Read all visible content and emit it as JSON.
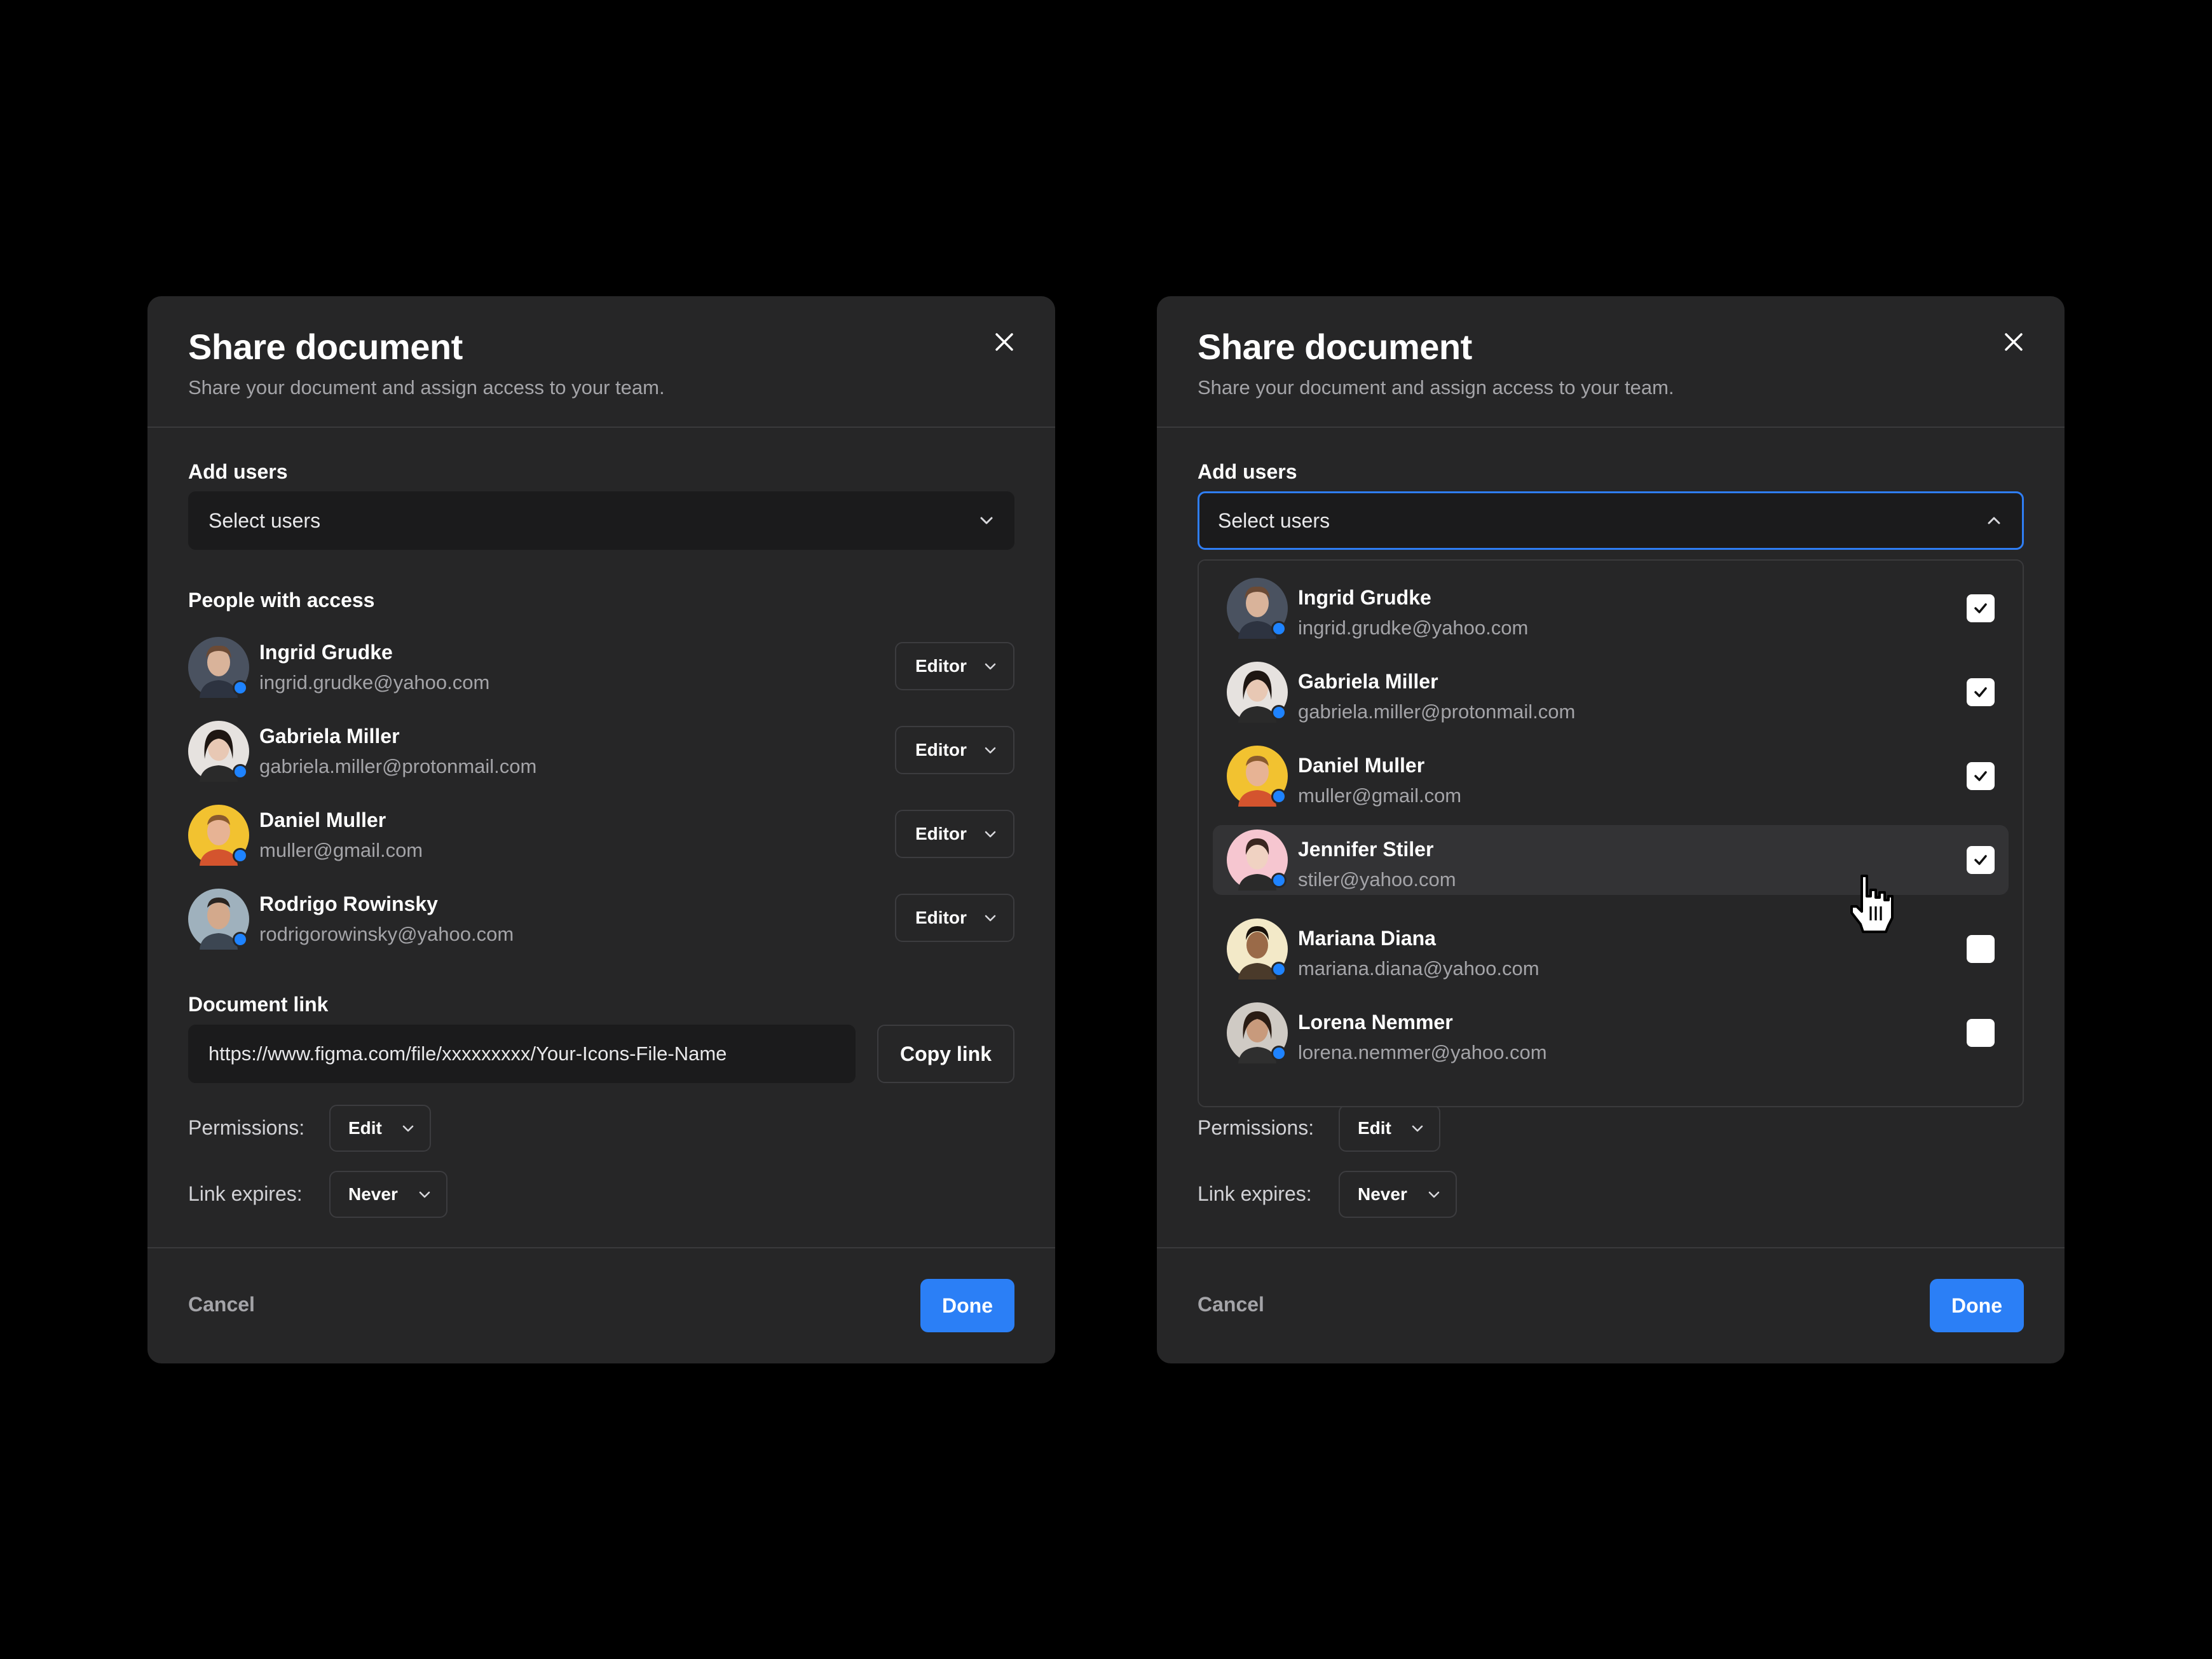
{
  "left_modal": {
    "title": "Share document",
    "subtitle": "Share your document and assign access to your team.",
    "add_users_label": "Add users",
    "select_placeholder": "Select users",
    "people_label": "People with access",
    "people": [
      {
        "name": "Ingrid Grudke",
        "email": "ingrid.grudke@yahoo.com",
        "role": "Editor"
      },
      {
        "name": "Gabriela Miller",
        "email": "gabriela.miller@protonmail.com",
        "role": "Editor"
      },
      {
        "name": "Daniel Muller",
        "email": "muller@gmail.com",
        "role": "Editor"
      },
      {
        "name": "Rodrigo Rowinsky",
        "email": "rodrigorowinsky@yahoo.com",
        "role": "Editor"
      }
    ],
    "document_link_label": "Document link",
    "link_value": "https://www.figma.com/file/xxxxxxxxx/Your-Icons-File-Name",
    "copy_link_label": "Copy link",
    "permissions_label": "Permissions:",
    "permissions_value": "Edit",
    "expires_label": "Link expires:",
    "expires_value": "Never",
    "cancel_label": "Cancel",
    "done_label": "Done"
  },
  "right_modal": {
    "title": "Share document",
    "subtitle": "Share your document and assign access to your team.",
    "add_users_label": "Add users",
    "select_placeholder": "Select users",
    "dropdown_users": [
      {
        "name": "Ingrid Grudke",
        "email": "ingrid.grudke@yahoo.com",
        "checked": true
      },
      {
        "name": "Gabriela Miller",
        "email": "gabriela.miller@protonmail.com",
        "checked": true
      },
      {
        "name": "Daniel Muller",
        "email": "muller@gmail.com",
        "checked": true
      },
      {
        "name": "Jennifer Stiler",
        "email": "stiler@yahoo.com",
        "checked": true
      },
      {
        "name": "Mariana Diana",
        "email": "mariana.diana@yahoo.com",
        "checked": false
      },
      {
        "name": "Lorena Nemmer",
        "email": "lorena.nemmer@yahoo.com",
        "checked": false
      }
    ],
    "permissions_label": "Permissions:",
    "permissions_value": "Edit",
    "expires_label": "Link expires:",
    "expires_value": "Never",
    "cancel_label": "Cancel",
    "done_label": "Done"
  },
  "colors": {
    "background": "#000000",
    "modal": "#262627",
    "accent": "#2b7ff6",
    "online_dot": "#1e83ff",
    "muted_text": "#a4a4a8"
  }
}
